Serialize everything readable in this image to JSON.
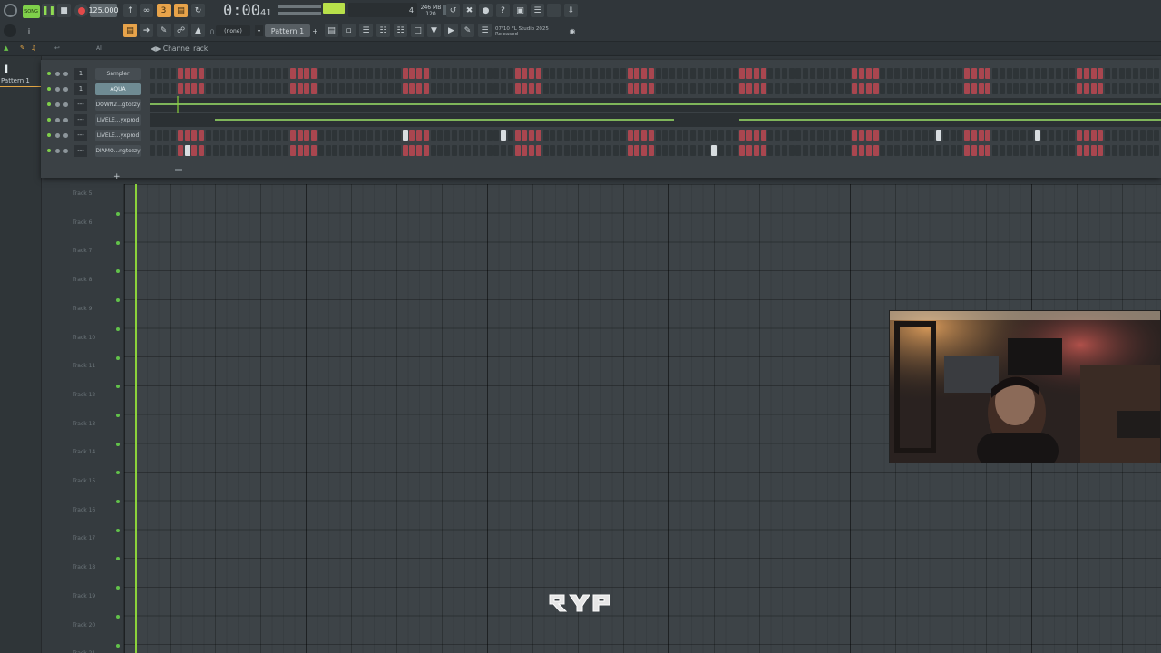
{
  "toolbar": {
    "tempo": "125.000",
    "time": "0:00",
    "time_small": "41",
    "memory": "246 MB",
    "memory_sub": "120",
    "cpu_meter_label": "4",
    "pattern": "Pattern 1",
    "none_select": "(none)",
    "hint_counter": "07/10",
    "hint_title": "FL Studio 2025 |",
    "hint_sub": "Released",
    "song_label": "SONG"
  },
  "browser": {
    "filter": "All",
    "title": "Channel rack"
  },
  "leftpanel": {
    "pattern_item": "Pattern 1"
  },
  "channels": [
    {
      "num": "1",
      "name": "Sampler"
    },
    {
      "num": "1",
      "name": "AQUA"
    },
    {
      "num": "---",
      "name": "DOWN2...gtozzy"
    },
    {
      "num": "---",
      "name": "LIVELE...yxprod"
    },
    {
      "num": "---",
      "name": "LIVELE...yxprod"
    },
    {
      "num": "---",
      "name": "DIAMO...ngtozzy"
    }
  ],
  "tracks": [
    "Track 5",
    "Track 6",
    "Track 7",
    "Track 8",
    "Track 9",
    "Track 10",
    "Track 11",
    "Track 12",
    "Track 13",
    "Track 14",
    "Track 15",
    "Track 16",
    "Track 17",
    "Track 18",
    "Track 19",
    "Track 20",
    "Track 21"
  ],
  "overlay": {
    "logo_text": "qyp"
  },
  "colors": {
    "accent_green": "#8bd23b",
    "step_red": "#a9464f",
    "step_dark": "#2e3437",
    "toolbar_orange": "#e7a34a"
  }
}
